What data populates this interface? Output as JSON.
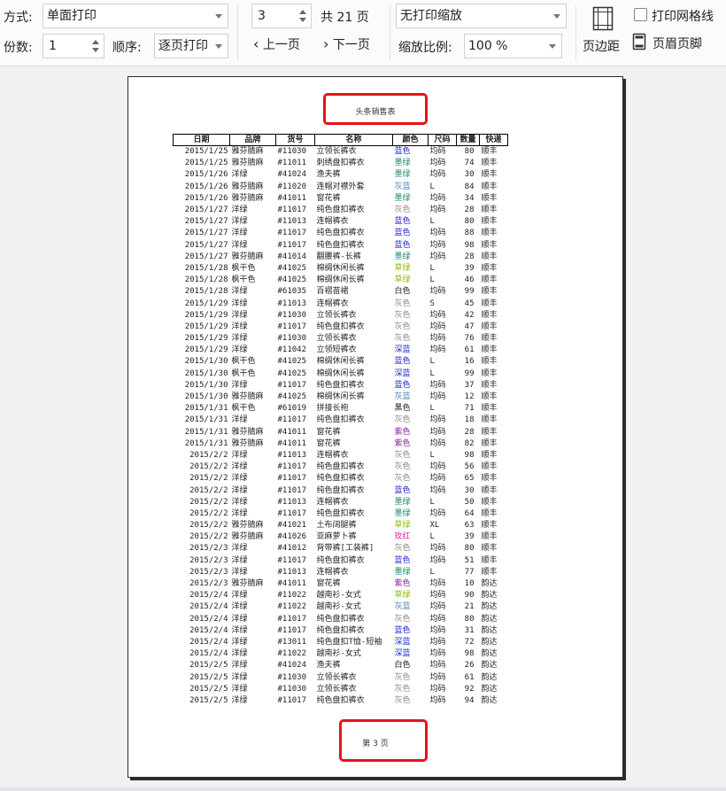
{
  "toolbar": {
    "print_mode_label": "方式:",
    "print_mode_value": "单面打印",
    "copies_label": "份数:",
    "copies_value": "1",
    "order_label": "顺序:",
    "order_value": "逐页打印",
    "page_value": "3",
    "total_pages": "共 21 页",
    "prev_page": "上一页",
    "next_page": "下一页",
    "scale_mode_value": "无打印缩放",
    "zoom_label": "缩放比例:",
    "zoom_value": "100 %",
    "margins_label": "页边距",
    "gridlines_label": "打印网格线",
    "header_footer_label": "页眉页脚"
  },
  "preview": {
    "sheet_title": "头条销售表",
    "footer_text": "第 3 页",
    "highlight_color": "#e8121b",
    "headers": [
      "日期",
      "品牌",
      "货号",
      "名称",
      "颜色",
      "尺码",
      "数量",
      "快递"
    ],
    "color_map": {
      "蓝色": "#2323d6",
      "墨绿": "#1c8a6e",
      "灰色": "#8c8c8c",
      "灰蓝": "#4d86b8",
      "草绿": "#8fb800",
      "深蓝": "#1c2fc8",
      "白色": "#222222",
      "黑色": "#222222",
      "紫色": "#8a1fa8",
      "玫红": "#e0209a"
    },
    "rows": [
      [
        "2015/1/25",
        "雅芬腈麻",
        "#11030",
        "立领长裤衣",
        "蓝色",
        "均码",
        "80",
        "顺丰"
      ],
      [
        "2015/1/25",
        "雅芬腈麻",
        "#11011",
        "刺绣盘扣裤衣",
        "墨绿",
        "均码",
        "74",
        "顺丰"
      ],
      [
        "2015/1/26",
        "洋绿",
        "#41024",
        "渔夫裤",
        "墨绿",
        "均码",
        "30",
        "顺丰"
      ],
      [
        "2015/1/26",
        "雅芬腈麻",
        "#11020",
        "连帽对襟外套",
        "灰蓝",
        "L",
        "84",
        "顺丰"
      ],
      [
        "2015/1/26",
        "雅芬腈麻",
        "#41011",
        "窗花裤",
        "墨绿",
        "均码",
        "34",
        "顺丰"
      ],
      [
        "2015/1/27",
        "洋绿",
        "#11017",
        "纯色盘扣裤衣",
        "灰色",
        "均码",
        "28",
        "顺丰"
      ],
      [
        "2015/1/27",
        "洋绿",
        "#11013",
        "连帽裤衣",
        "蓝色",
        "L",
        "80",
        "顺丰"
      ],
      [
        "2015/1/27",
        "洋绿",
        "#11017",
        "纯色盘扣裤衣",
        "蓝色",
        "均码",
        "88",
        "顺丰"
      ],
      [
        "2015/1/27",
        "洋绿",
        "#11017",
        "纯色盘扣裤衣",
        "蓝色",
        "均码",
        "98",
        "顺丰"
      ],
      [
        "2015/1/27",
        "雅芬腈麻",
        "#41014",
        "翻腰裤-长裤",
        "墨绿",
        "均码",
        "28",
        "顺丰"
      ],
      [
        "2015/1/28",
        "枫干色",
        "#41025",
        "棉绸休闲长裤",
        "草绿",
        "L",
        "39",
        "顺丰"
      ],
      [
        "2015/1/28",
        "枫干色",
        "#41025",
        "棉绸休闲长裤",
        "草绿",
        "L",
        "46",
        "顺丰"
      ],
      [
        "2015/1/28",
        "洋绿",
        "#61035",
        "百褶苗裙",
        "白色",
        "均码",
        "99",
        "顺丰"
      ],
      [
        "2015/1/29",
        "洋绿",
        "#11013",
        "连帽裤衣",
        "灰色",
        "S",
        "45",
        "顺丰"
      ],
      [
        "2015/1/29",
        "洋绿",
        "#11030",
        "立领长裤衣",
        "灰色",
        "均码",
        "42",
        "顺丰"
      ],
      [
        "2015/1/29",
        "洋绿",
        "#11017",
        "纯色盘扣裤衣",
        "灰色",
        "均码",
        "47",
        "顺丰"
      ],
      [
        "2015/1/29",
        "洋绿",
        "#11030",
        "立领长裤衣",
        "灰色",
        "均码",
        "76",
        "顺丰"
      ],
      [
        "2015/1/29",
        "洋绿",
        "#11042",
        "立领短裤衣",
        "深蓝",
        "均码",
        "61",
        "顺丰"
      ],
      [
        "2015/1/30",
        "枫干色",
        "#41025",
        "棉绸休闲长裤",
        "蓝色",
        "L",
        "16",
        "顺丰"
      ],
      [
        "2015/1/30",
        "枫干色",
        "#41025",
        "棉绸休闲长裤",
        "深蓝",
        "L",
        "99",
        "顺丰"
      ],
      [
        "2015/1/30",
        "洋绿",
        "#11017",
        "纯色盘扣裤衣",
        "蓝色",
        "均码",
        "37",
        "顺丰"
      ],
      [
        "2015/1/30",
        "雅芬腈麻",
        "#41025",
        "棉绸休闲长裤",
        "灰蓝",
        "均码",
        "12",
        "顺丰"
      ],
      [
        "2015/1/31",
        "枫干色",
        "#61019",
        "拼接长袍",
        "黑色",
        "L",
        "71",
        "顺丰"
      ],
      [
        "2015/1/31",
        "洋绿",
        "#11017",
        "纯色盘扣裤衣",
        "灰色",
        "均码",
        "18",
        "顺丰"
      ],
      [
        "2015/1/31",
        "雅芬腈麻",
        "#41011",
        "窗花裤",
        "紫色",
        "均码",
        "28",
        "顺丰"
      ],
      [
        "2015/1/31",
        "雅芬腈麻",
        "#41011",
        "窗花裤",
        "紫色",
        "均码",
        "82",
        "顺丰"
      ],
      [
        "2015/2/2",
        "洋绿",
        "#11013",
        "连帽裤衣",
        "灰色",
        "L",
        "98",
        "顺丰"
      ],
      [
        "2015/2/2",
        "洋绿",
        "#11017",
        "纯色盘扣裤衣",
        "灰色",
        "均码",
        "56",
        "顺丰"
      ],
      [
        "2015/2/2",
        "洋绿",
        "#11017",
        "纯色盘扣裤衣",
        "灰色",
        "均码",
        "65",
        "顺丰"
      ],
      [
        "2015/2/2",
        "洋绿",
        "#11017",
        "纯色盘扣裤衣",
        "蓝色",
        "均码",
        "30",
        "顺丰"
      ],
      [
        "2015/2/2",
        "洋绿",
        "#11013",
        "连帽裤衣",
        "墨绿",
        "L",
        "50",
        "顺丰"
      ],
      [
        "2015/2/2",
        "洋绿",
        "#11017",
        "纯色盘扣裤衣",
        "墨绿",
        "均码",
        "64",
        "顺丰"
      ],
      [
        "2015/2/2",
        "雅芬腈麻",
        "#41021",
        "土布阔腿裤",
        "草绿",
        "XL",
        "63",
        "顺丰"
      ],
      [
        "2015/2/2",
        "雅芬腈麻",
        "#41026",
        "亚麻萝卜裤",
        "玫红",
        "L",
        "39",
        "顺丰"
      ],
      [
        "2015/2/3",
        "洋绿",
        "#41012",
        "背带裤[工装裤]",
        "灰色",
        "均码",
        "80",
        "顺丰"
      ],
      [
        "2015/2/3",
        "洋绿",
        "#11017",
        "纯色盘扣裤衣",
        "蓝色",
        "均码",
        "51",
        "顺丰"
      ],
      [
        "2015/2/3",
        "洋绿",
        "#11013",
        "连帽裤衣",
        "墨绿",
        "L",
        "77",
        "顺丰"
      ],
      [
        "2015/2/3",
        "雅芬腈麻",
        "#41011",
        "窗花裤",
        "紫色",
        "均码",
        "10",
        "韵达"
      ],
      [
        "2015/2/4",
        "洋绿",
        "#11022",
        "越南衫-女式",
        "草绿",
        "均码",
        "90",
        "韵达"
      ],
      [
        "2015/2/4",
        "洋绿",
        "#11022",
        "越南衫-女式",
        "灰蓝",
        "均码",
        "21",
        "韵达"
      ],
      [
        "2015/2/4",
        "洋绿",
        "#11017",
        "纯色盘扣裤衣",
        "灰色",
        "均码",
        "80",
        "韵达"
      ],
      [
        "2015/2/4",
        "洋绿",
        "#11017",
        "纯色盘扣裤衣",
        "蓝色",
        "均码",
        "31",
        "韵达"
      ],
      [
        "2015/2/4",
        "洋绿",
        "#13011",
        "纯色盘扣T恤-短袖",
        "深蓝",
        "均码",
        "72",
        "韵达"
      ],
      [
        "2015/2/4",
        "洋绿",
        "#11022",
        "越南衫-女式",
        "深蓝",
        "均码",
        "98",
        "韵达"
      ],
      [
        "2015/2/5",
        "洋绿",
        "#41024",
        "渔夫裤",
        "白色",
        "均码",
        "26",
        "韵达"
      ],
      [
        "2015/2/5",
        "洋绿",
        "#11030",
        "立领长裤衣",
        "灰色",
        "均码",
        "61",
        "韵达"
      ],
      [
        "2015/2/5",
        "洋绿",
        "#11030",
        "立领长裤衣",
        "灰色",
        "均码",
        "92",
        "韵达"
      ],
      [
        "2015/2/5",
        "洋绿",
        "#11017",
        "纯色盘扣裤衣",
        "灰色",
        "均码",
        "94",
        "韵达"
      ]
    ]
  }
}
